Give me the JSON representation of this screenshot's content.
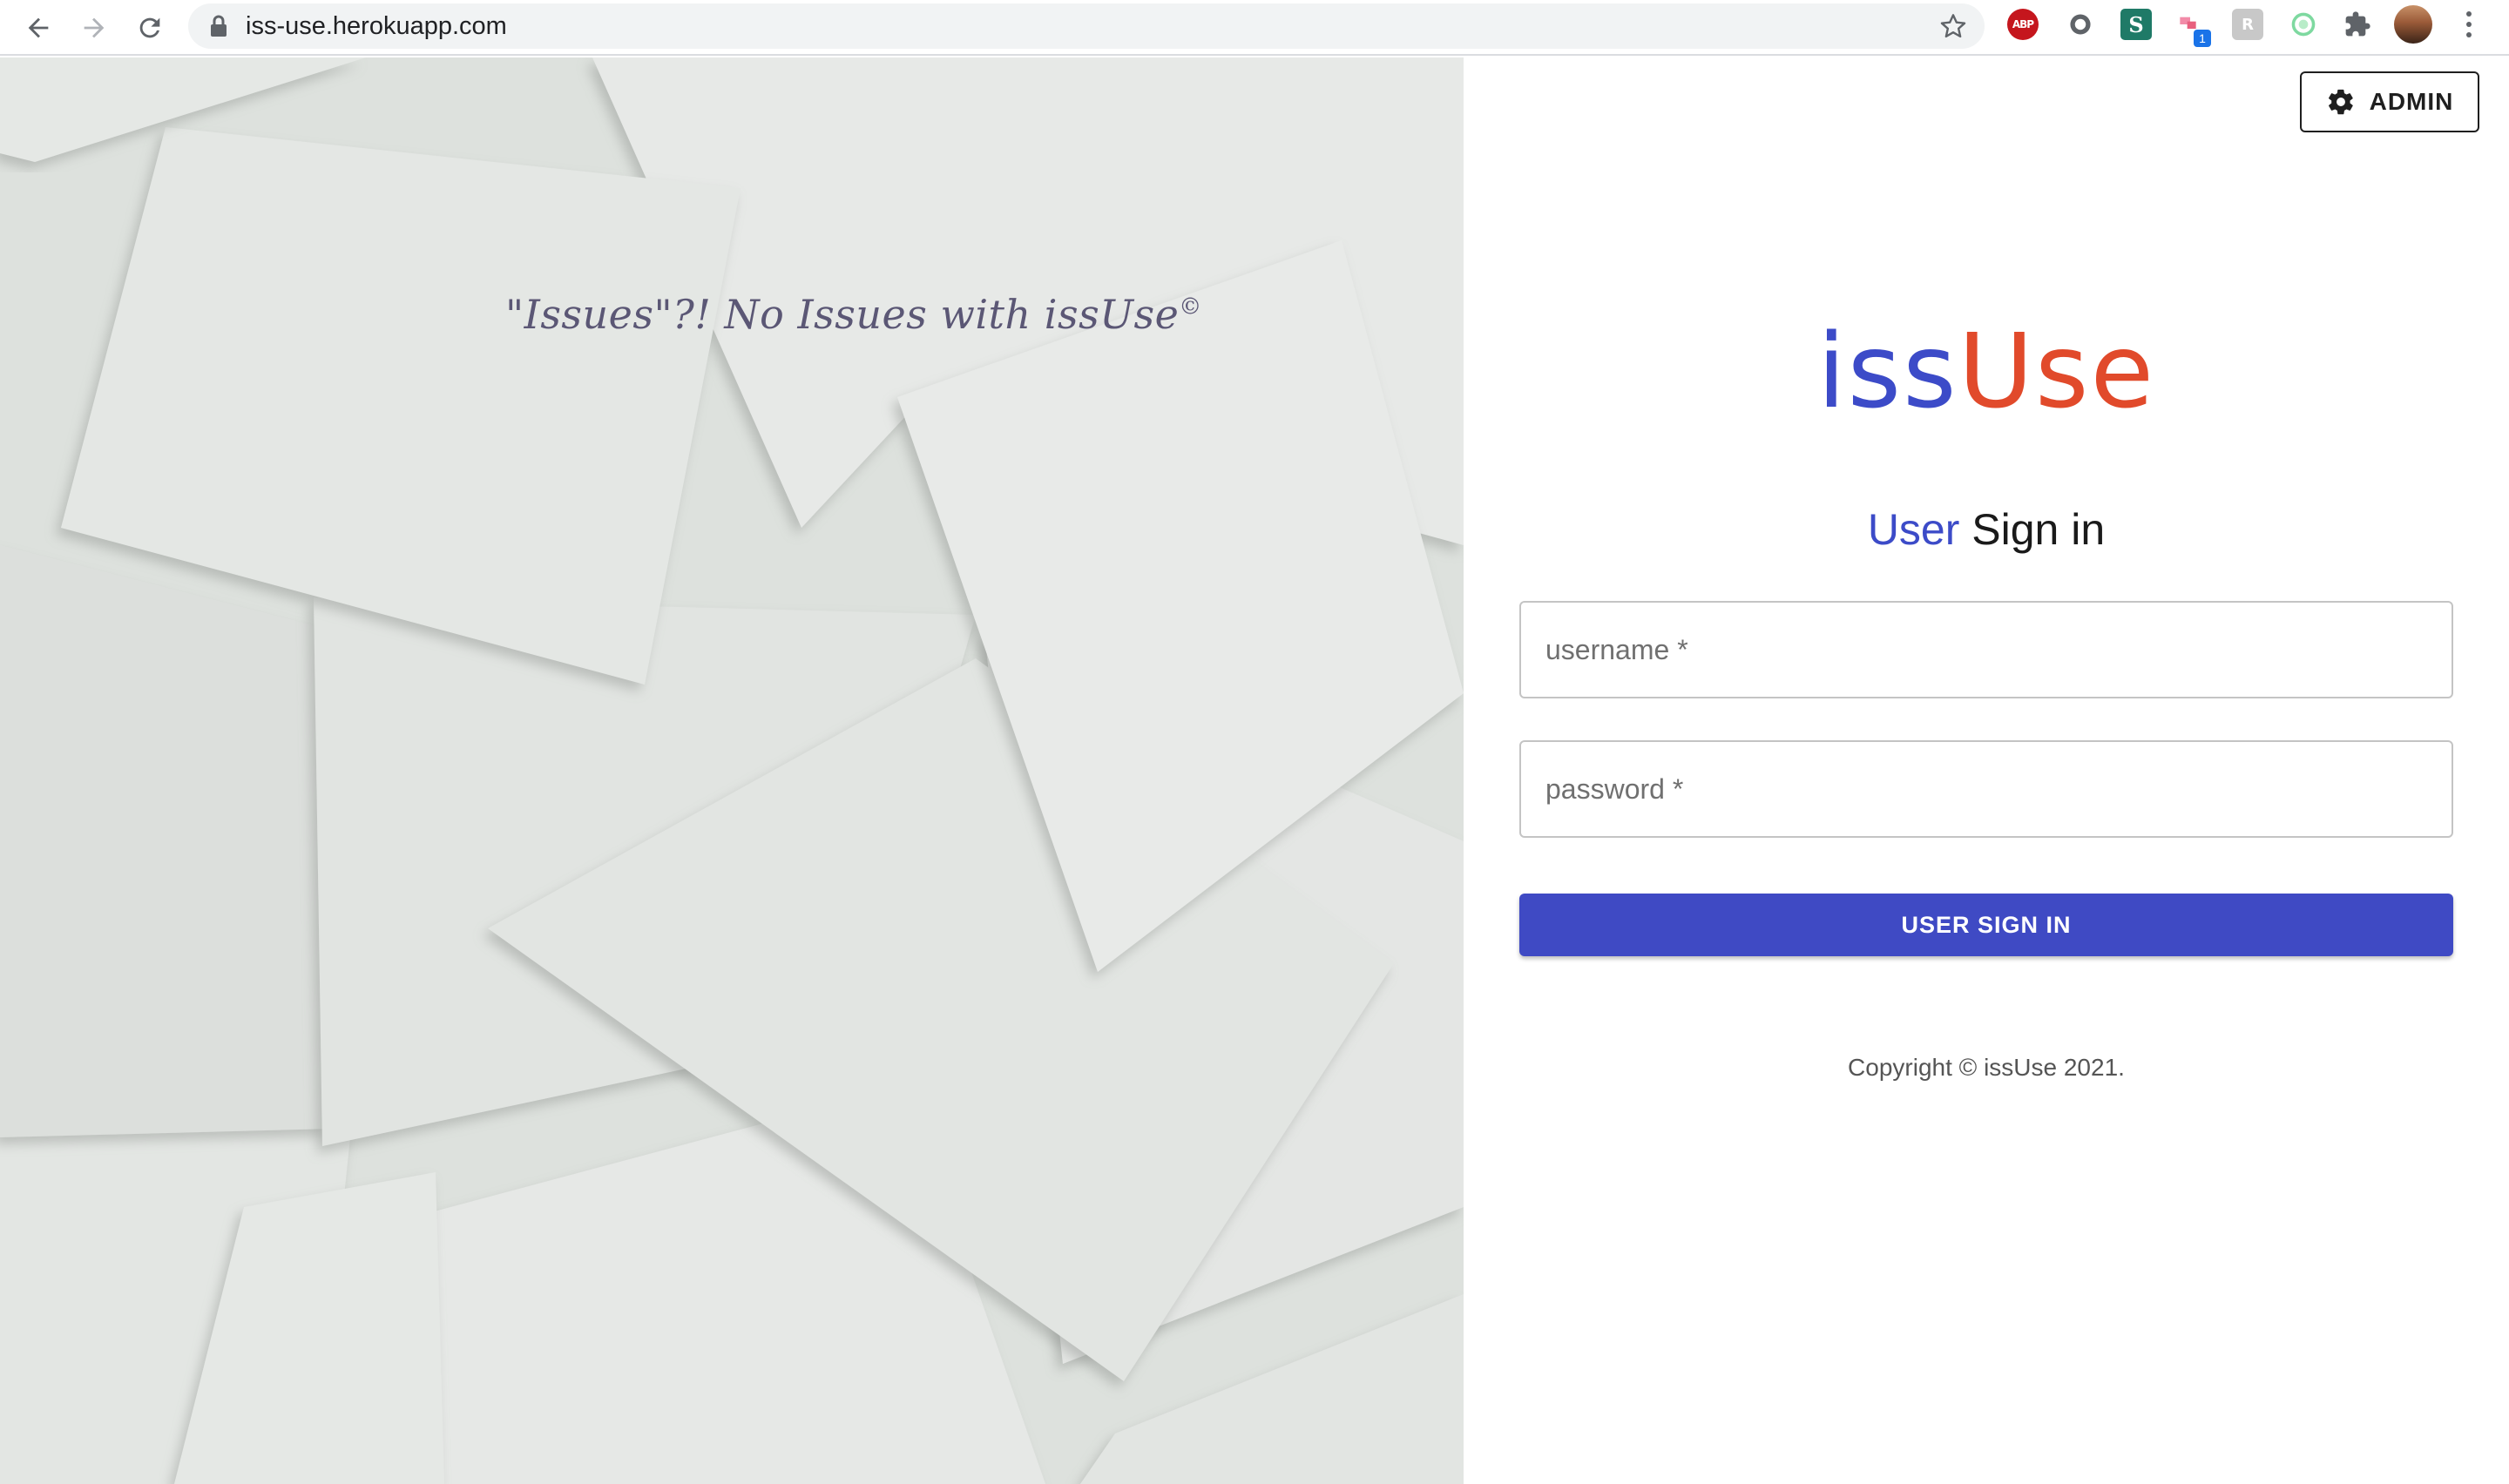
{
  "browser": {
    "url": "iss-use.herokuapp.com",
    "extensions": [
      {
        "name": "adblock-plus-icon",
        "label": "ABP"
      },
      {
        "name": "extension-circle-icon",
        "label": ""
      },
      {
        "name": "extension-s-icon",
        "label": "S"
      },
      {
        "name": "extension-badge-icon",
        "label": "",
        "badge": "1"
      },
      {
        "name": "extension-grey-icon",
        "label": "R"
      },
      {
        "name": "extension-ring-icon",
        "label": ""
      }
    ]
  },
  "hero": {
    "tagline": "\"Issues\"?! No Issues with issUse",
    "tagline_mark": "©"
  },
  "header": {
    "admin_label": "ADMIN"
  },
  "logo": {
    "part1": "iss",
    "part2": "Use"
  },
  "signin": {
    "heading_accent": "User",
    "heading_rest": " Sign in",
    "username_placeholder": "username *",
    "password_placeholder": "password *",
    "button_label": "USER SIGN IN"
  },
  "footer": {
    "copyright": "Copyright © issUse 2021."
  },
  "colors": {
    "primary": "#3f4ac4",
    "logo_blue": "#3c4bc8",
    "logo_orange": "#e14a2b"
  }
}
